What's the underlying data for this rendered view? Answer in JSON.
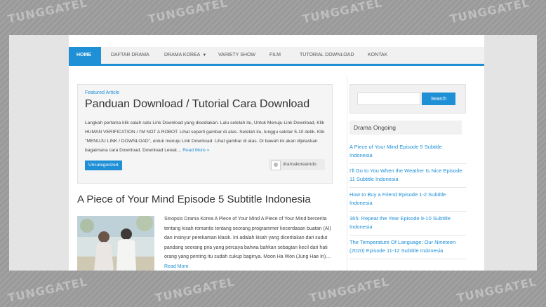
{
  "watermark": "TUNGGATEL",
  "nav": {
    "items": [
      {
        "label": "HOME",
        "active": true
      },
      {
        "label": "DAFTAR DRAMA"
      },
      {
        "label": "DRAMA KOREA",
        "dropdown": true
      },
      {
        "label": "VARIETY SHOW"
      },
      {
        "label": "FILM"
      },
      {
        "label": "TUTORIAL DOWNLOAD"
      },
      {
        "label": "KONTAK"
      }
    ],
    "caret": "▼"
  },
  "featured": {
    "tag": "Featured Article",
    "title": "Panduan Download / Tutorial Cara Download",
    "excerpt": "Langkah pertama klik salah satu Link Download yang disediakan. Lalu setelah itu, Untuk Menuju Link Download, Klik HUMAN VERIFICATION / I'M NOT A ROBOT. Lihat seperti gambar di atas. Setelah itu, tunggu sekitar 5-10 detik. Klik \"MENUJU LINK / DOWNLOAD\", untuk menuju Link Download. Lihat gambar di atas. Di bawah ini akan dijelaskan bagaimana cara Download. Download Lewat…",
    "read_more": "Read More »",
    "category": "Uncategorized",
    "author": "dramakoreaindo"
  },
  "post": {
    "title": "A Piece of Your Mind Episode 5 Subtitle Indonesia",
    "excerpt": "Sinopsis Drama Korea A Piece of Your Mind A Piece of Your Mind bercerita tentang kisah romantis tentang seorang programmer kecerdasan buatan (AI) dan insinyur perekaman klasik. Ini adalah kisah yang diceritakan dari sudut pandang seorang pria yang percaya bahwa bahkan sebagian kecil dari hati orang yang penting itu sudah cukup baginya. Moon Ha Won (Jung Hae In)…",
    "read_more": "Read More"
  },
  "sidebar": {
    "search_button": "Search",
    "widget_title": "Drama Ongoing",
    "ongoing": [
      "A Piece of Your Mind Episode 5 Subtitle Indonesia",
      "I'll Go to You When the Weather Is Nice Episode 11 Subtitle Indonesia",
      "How to Buy a Friend Episode 1-2 Subtitle Indonesia",
      "365: Repeat the Year Episode 9-10 Subtitle Indonesia",
      "The Temperature Of Language: Our Nineteen (2020) Episode 11-12 Subtitle Indonesia"
    ]
  },
  "colors": {
    "accent": "#1f8fd6"
  }
}
